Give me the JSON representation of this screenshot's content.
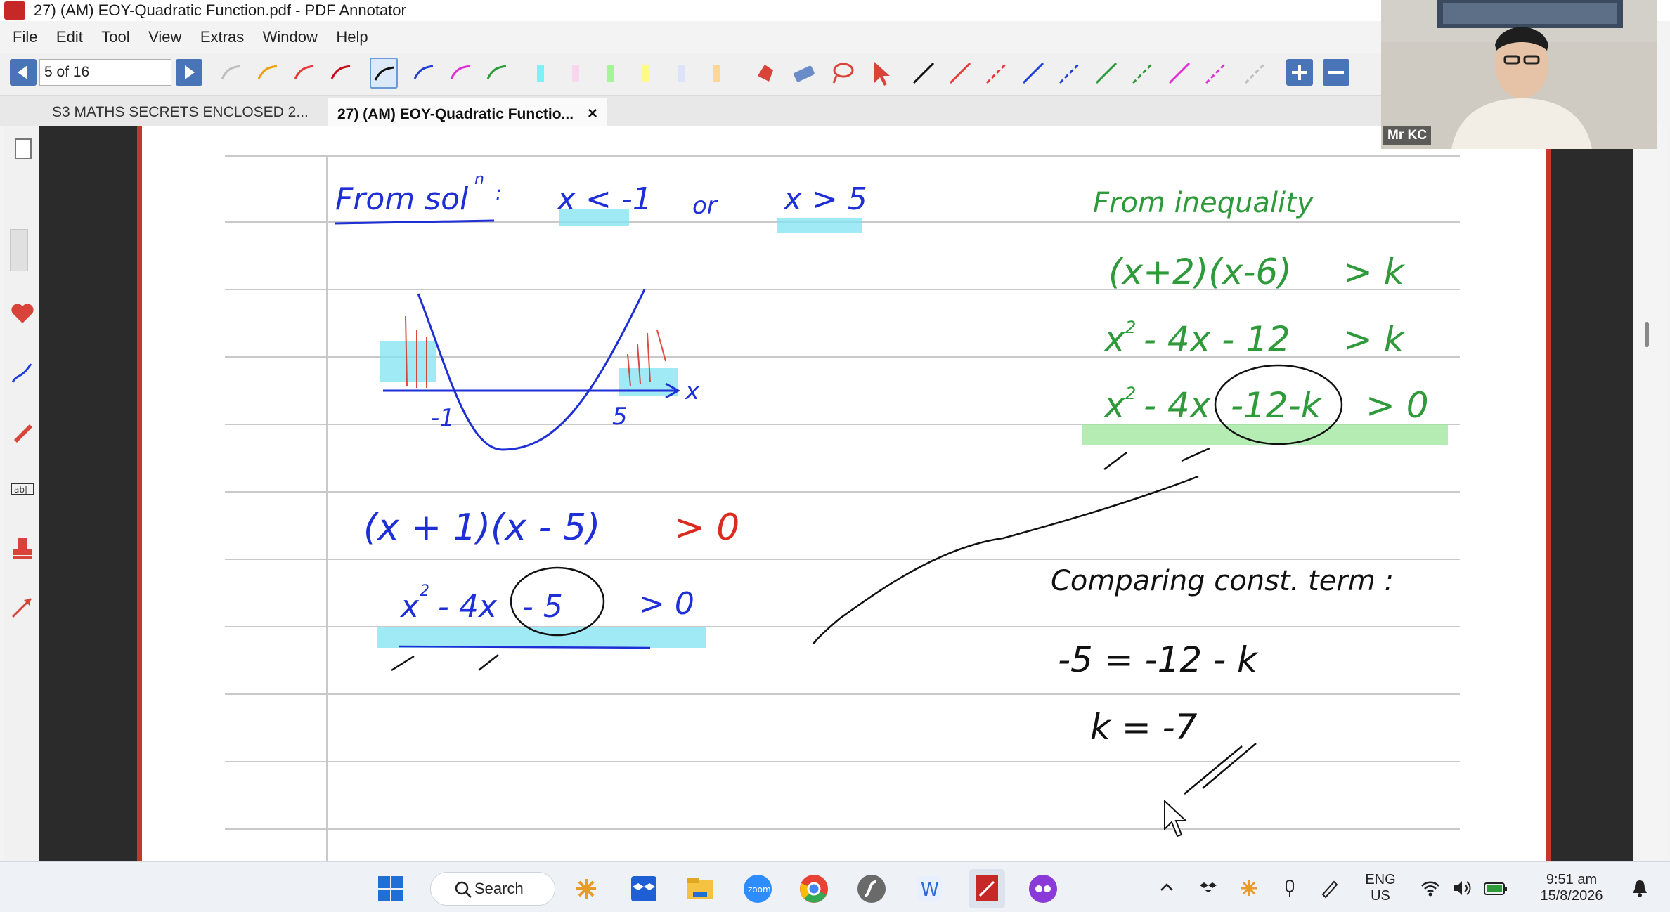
{
  "window": {
    "title": "27) (AM) EOY-Quadratic Function.pdf - PDF Annotator"
  },
  "menu": {
    "items": [
      "File",
      "Edit",
      "Tool",
      "View",
      "Extras",
      "Window",
      "Help"
    ]
  },
  "toolbar": {
    "page_indicator": "5 of 16"
  },
  "tabs": [
    {
      "label": "S3 MATHS SECRETS ENCLOSED 2..."
    },
    {
      "label": "27) (AM) EOY-Quadratic Functio..."
    }
  ],
  "tab_close": "×",
  "webcam": {
    "name": "Mr KC"
  },
  "notes": {
    "from_sol": "From sol",
    "sol_n": "n",
    "sol_colon": ":",
    "cond1": "x < -1",
    "or": "or",
    "cond2": "x > 5",
    "graph_axis": "x",
    "graph_root1": "-1",
    "graph_root2": "5",
    "factored": "(x + 1)(x - 5)",
    "factored_gt": "> 0",
    "expanded_1": "x",
    "expanded_2": "2",
    "expanded_3": "- 4x",
    "expanded_4": "- 5",
    "expanded_5": "> 0",
    "from_ineq": "From inequality",
    "ineq1_a": "(x+2)(x-6)",
    "ineq1_b": "> k",
    "ineq2_a": "x",
    "ineq2_b": "2",
    "ineq2_c": "- 4x - 12",
    "ineq2_d": "> k",
    "ineq3_a": "x",
    "ineq3_b": "2",
    "ineq3_c": "- 4x",
    "ineq3_d": "-12-k",
    "ineq3_e": "> 0",
    "comparing": "Comparing const. term :",
    "eq1": "-5 = -12 - k",
    "eq2": "k = -7"
  },
  "taskbar": {
    "search_label": "Search",
    "lang1": "ENG",
    "lang2": "US",
    "time": "9:51 am",
    "date": "15/8/2026"
  },
  "colors": {
    "ink_blue": "#1f2fd6",
    "ink_green": "#2e9a3a",
    "ink_red": "#d92b1f",
    "highlight_cyan": "#7fe3f0",
    "highlight_green": "#9be59b"
  }
}
